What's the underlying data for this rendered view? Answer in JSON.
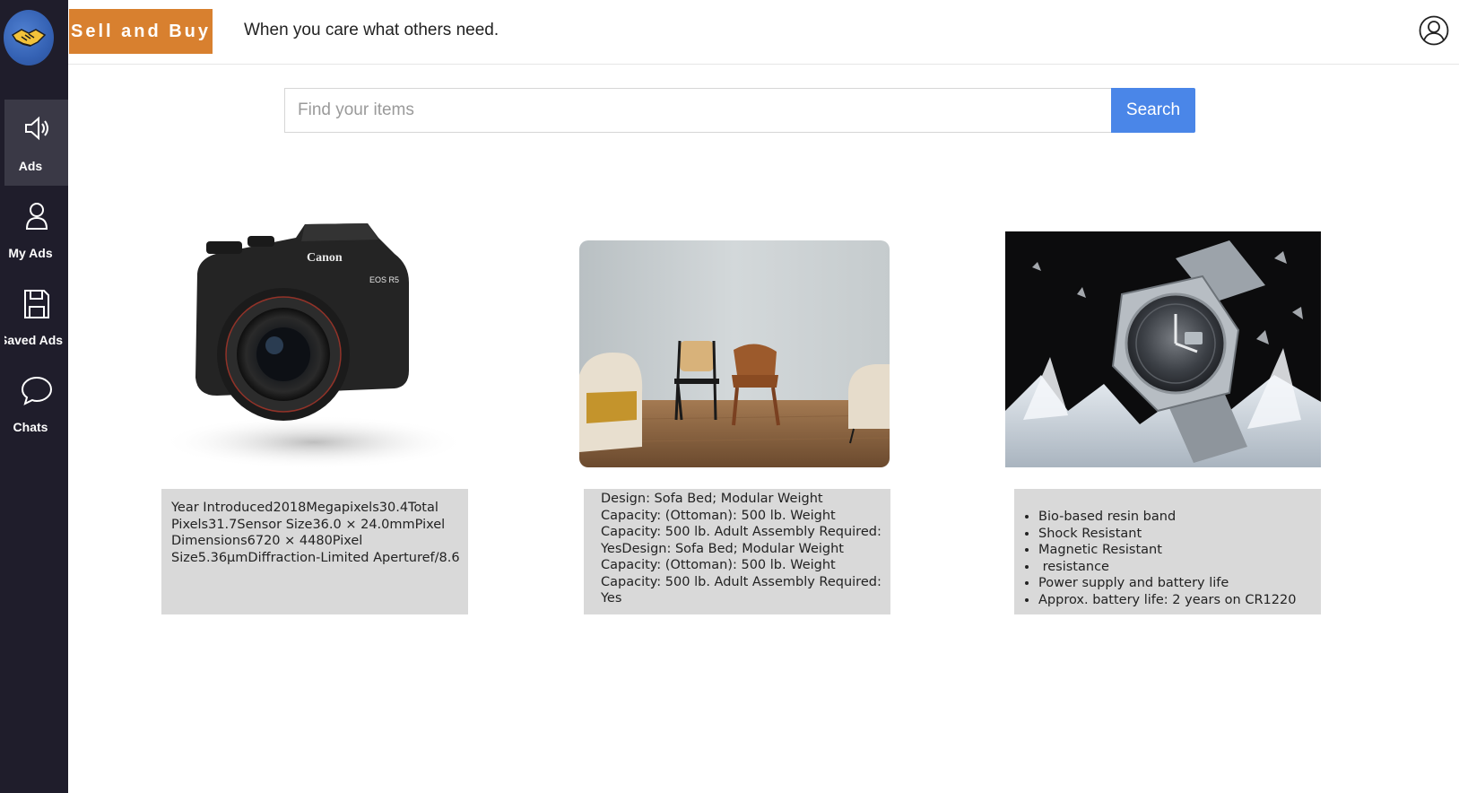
{
  "app": {
    "brand": "Sell and Buy",
    "tagline": "When you care what others need.",
    "accent_color": "#d8802f",
    "sidebar_color": "#1f1d2b"
  },
  "sidebar": {
    "items": [
      {
        "label": "Ads",
        "icon": "megaphone-icon",
        "active": true
      },
      {
        "label": "My Ads",
        "icon": "person-icon",
        "active": false
      },
      {
        "label": "Saved Ads",
        "icon": "save-icon",
        "active": false
      },
      {
        "label": "Chats",
        "icon": "chat-bubble-icon",
        "active": false
      }
    ]
  },
  "search": {
    "placeholder": "Find your items",
    "value": "",
    "button_label": "Search",
    "button_color": "#4a86e8"
  },
  "listings": [
    {
      "image": "camera-photo",
      "description": "Year Introduced2018Megapixels30.4Total Pixels31.7Sensor Size36.0 × 24.0mmPixel Dimensions6720 × 4480Pixel Size5.36µmDiffraction-Limited Aperturef/8.6",
      "image_text": {
        "brand": "Canon",
        "model": "EOS R5"
      }
    },
    {
      "image": "furniture-photo",
      "description": "Design: Sofa Bed; Modular Weight Capacity: (Ottoman): 500 lb. Weight Capacity: 500 lb. Adult Assembly Required: YesDesign: Sofa Bed; Modular Weight Capacity: (Ottoman): 500 lb. Weight Capacity: 500 lb. Adult Assembly Required: Yes"
    },
    {
      "image": "watch-photo",
      "bullets": [
        "Bio-based resin band",
        "Shock Resistant",
        "Magnetic Resistant",
        " resistance",
        "Power supply and battery life",
        "Approx. battery life: 2 years on CR1220"
      ]
    }
  ]
}
